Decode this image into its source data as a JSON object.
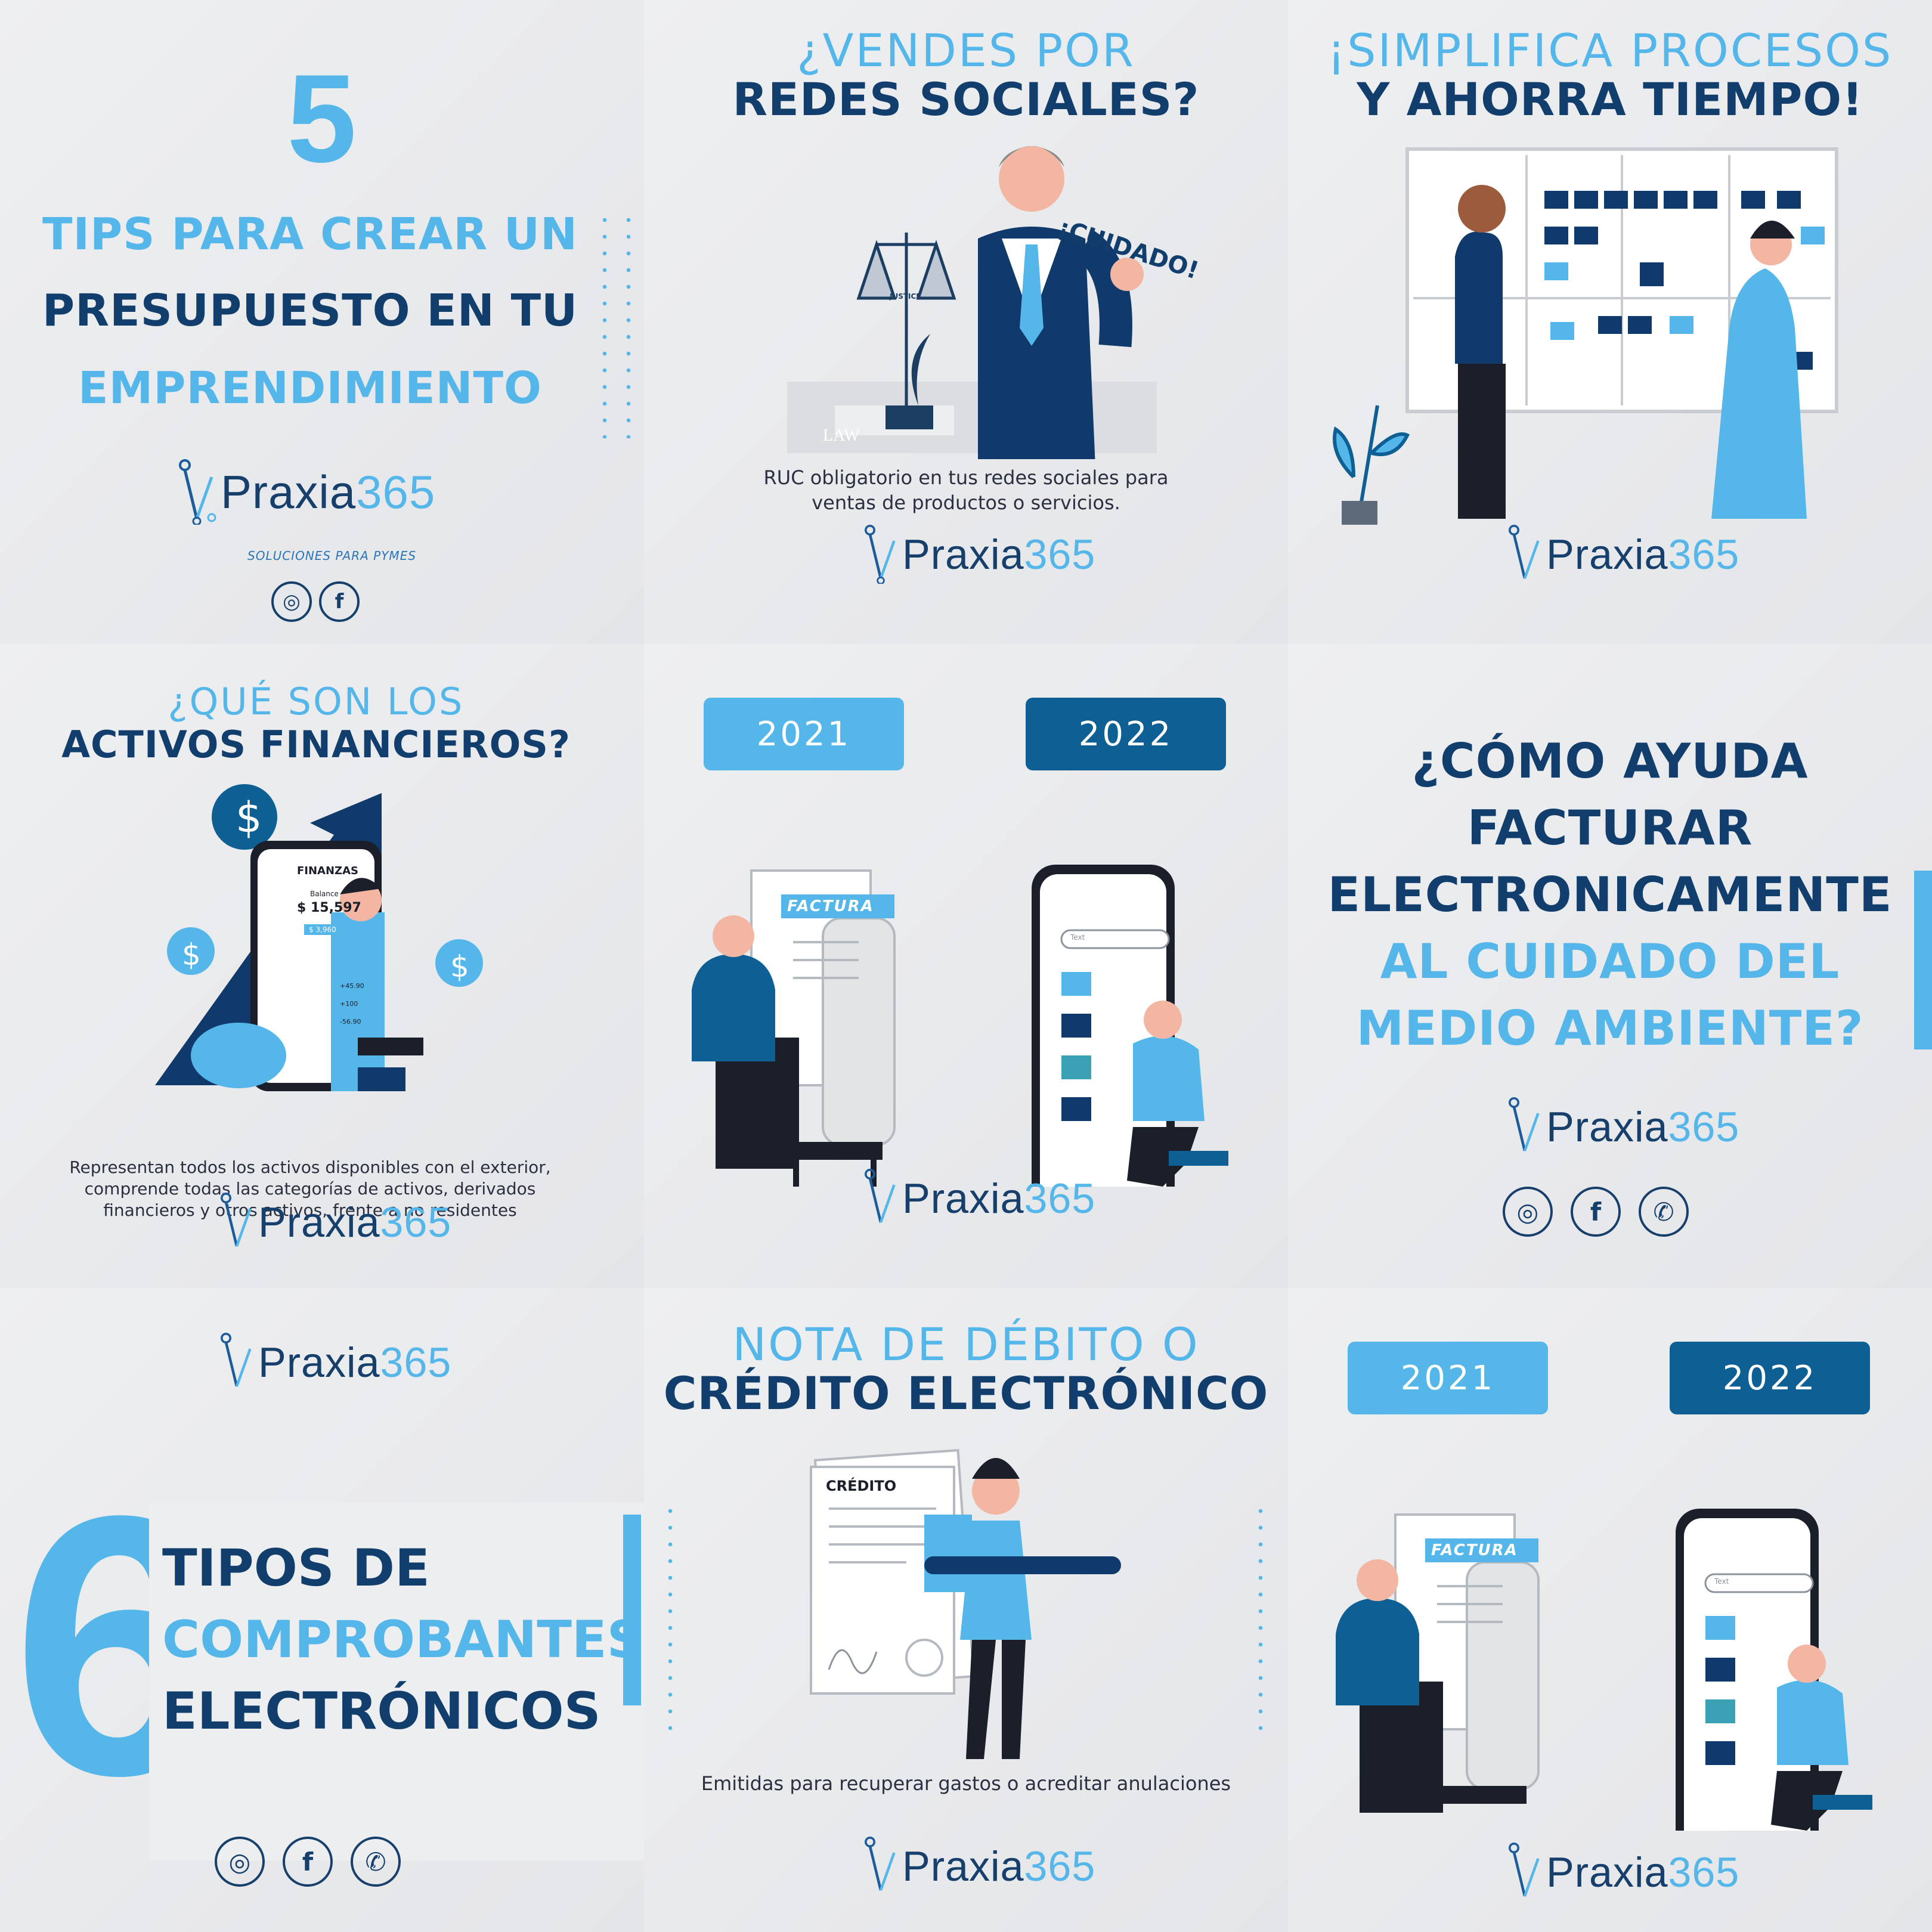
{
  "brand": {
    "name": "Praxia",
    "number": "365",
    "tagline": "SOLUCIONES PARA PYMES"
  },
  "social": {
    "instagram": "◎",
    "facebook": "f",
    "whatsapp": "✆"
  },
  "colors": {
    "light_blue": "#55b6ea",
    "dark_blue": "#113e6c",
    "mid_blue": "#0d5f94"
  },
  "tile1": {
    "number": "5",
    "line1": "TIPS PARA CREAR UN",
    "line2": "PRESUPUESTO EN TU",
    "line3": "EMPRENDIMIENTO"
  },
  "tile2": {
    "title_top": "¿VENDES POR",
    "title_bottom": "REDES SOCIALES?",
    "badge": "¡CUIDADO!",
    "scale_label": "JUSTICE",
    "book_label": "LAW",
    "caption": [
      "RUC obligatorio en tus redes sociales para",
      "ventas de productos o servicios."
    ]
  },
  "tile3": {
    "title_top": "¡SIMPLIFICA PROCESOS",
    "title_bottom": "Y AHORRA TIEMPO!"
  },
  "tile4": {
    "title_top": "¿QUÉ SON LOS",
    "title_bottom": "ACTIVOS FINANCIEROS?",
    "app_title": "FINANZAS",
    "balance_label": "Balance",
    "balance_value": "$ 15,597",
    "button": "$ 3,960",
    "rows": [
      "+45.90",
      "+100",
      "-56.90"
    ],
    "caption": [
      "Representan todos los activos disponibles con el exterior,",
      "comprende todas las categorías de activos, derivados",
      "financieros y otros activos, frente a no residentes"
    ]
  },
  "tile5": {
    "year1": "2021",
    "year2": "2022",
    "invoice_label": "FACTURA",
    "search_placeholder": "Text"
  },
  "tile6": {
    "line1": "¿CÓMO AYUDA",
    "line2": "FACTURAR",
    "line3": "ELECTRONICAMENTE",
    "line4": "AL CUIDADO DEL",
    "line5": "MEDIO AMBIENTE?"
  },
  "tile7": {
    "number": "6",
    "line1": "TIPOS DE",
    "line2": "COMPROBANTES",
    "line3": "ELECTRÓNICOS"
  },
  "tile8": {
    "title_top": "NOTA DE DÉBITO O",
    "title_bottom": "CRÉDITO ELECTRÓNICO",
    "doc_label": "CRÉDITO",
    "caption": [
      "Emitidas para recuperar gastos o acreditar anulaciones"
    ]
  },
  "tile9": {
    "year1": "2021",
    "year2": "2022",
    "invoice_label": "FACTURA",
    "search_placeholder": "Text"
  }
}
